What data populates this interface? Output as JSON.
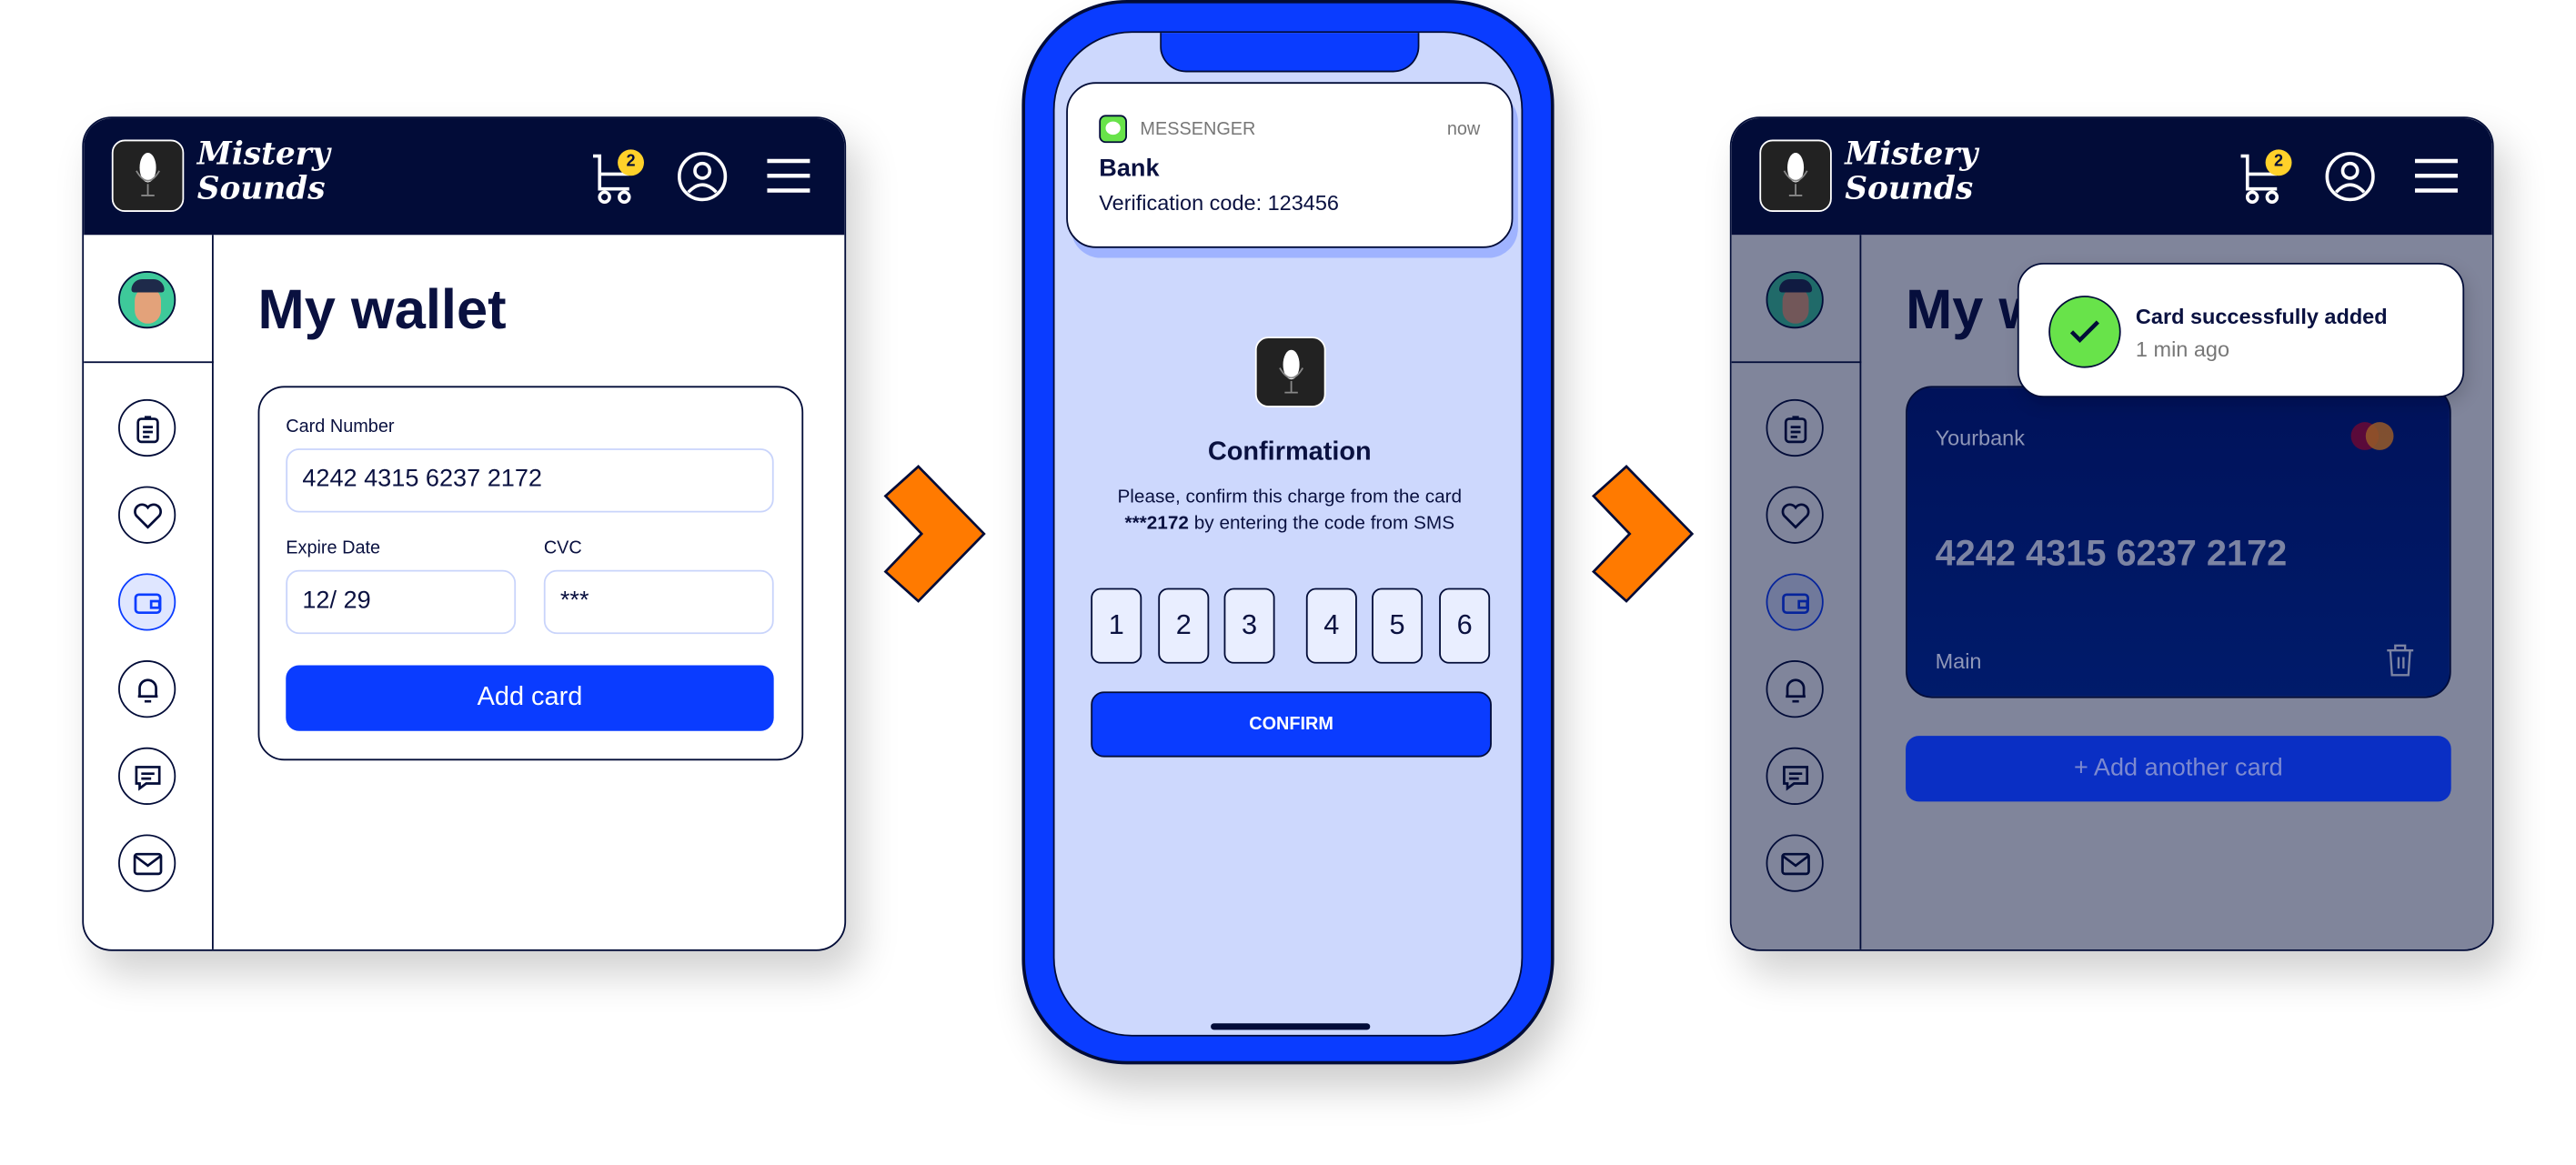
{
  "colors": {
    "navy": "#020c38",
    "primary": "#0a3cff",
    "phone_screen": "#cdd8fd",
    "arrow": "#ff7a00",
    "success": "#68e34a",
    "badge": "#ffd12a"
  },
  "brand": {
    "line1": "Mistery",
    "line2": "Sounds"
  },
  "header": {
    "cart_count": "2",
    "icons": [
      "cart-icon",
      "user-circle-icon",
      "hamburger-menu-icon"
    ]
  },
  "sidebar": {
    "icons": [
      "clipboard-icon",
      "heart-icon",
      "wallet-icon",
      "bell-icon",
      "chat-icon",
      "mail-icon"
    ],
    "active": "wallet-icon"
  },
  "step1": {
    "title": "My wallet",
    "card_number_label": "Card Number",
    "card_number_value": "4242 4315 6237 2172",
    "expire_label": "Expire Date",
    "expire_value": "12/ 29",
    "cvc_label": "CVC",
    "cvc_value": "***",
    "add_button": "Add card"
  },
  "step2": {
    "notification": {
      "app": "MESSENGER",
      "time": "now",
      "title": "Bank",
      "body": "Verification code: 123456"
    },
    "heading": "Confirmation",
    "text_line1": "Please, confirm this charge from the card",
    "text_masked": "***2172",
    "text_line2_rest": " by entering the code from SMS",
    "code": [
      "1",
      "2",
      "3",
      "4",
      "5",
      "6"
    ],
    "confirm_button": "CONFIRM"
  },
  "step3": {
    "title": "My wallet",
    "toast": {
      "title": "Card successfully added",
      "time": "1 min ago"
    },
    "card": {
      "bank": "Yourbank",
      "number": "4242 4315 6237 2172",
      "label": "Main"
    },
    "add_another": "+ Add another card"
  }
}
